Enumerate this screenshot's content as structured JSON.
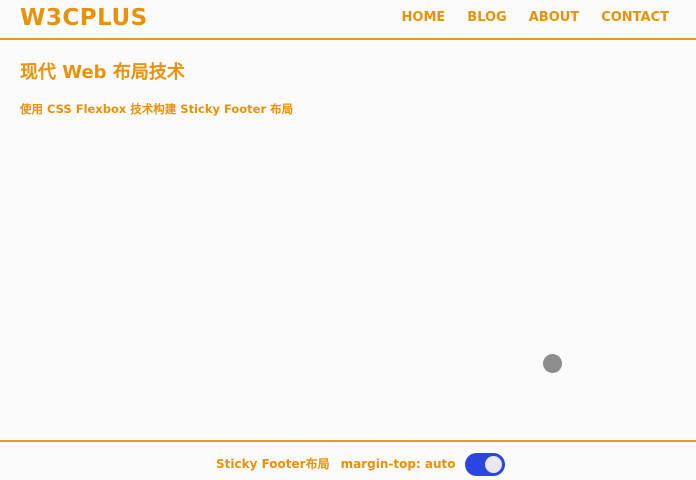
{
  "header": {
    "logo": "W3CPLUS",
    "nav": [
      "HOME",
      "BLOG",
      "ABOUT",
      "CONTACT"
    ]
  },
  "main": {
    "title": "现代 Web 布局技术",
    "subtitle": "使用 CSS Flexbox 技术构建 Sticky Footer 布局"
  },
  "footer": {
    "label": "Sticky Footer布局",
    "value": "margin-top: auto",
    "toggle_on": true
  },
  "colors": {
    "accent": "#e8910a",
    "toggle": "#2b45e0",
    "background": "#fbfbfb"
  }
}
